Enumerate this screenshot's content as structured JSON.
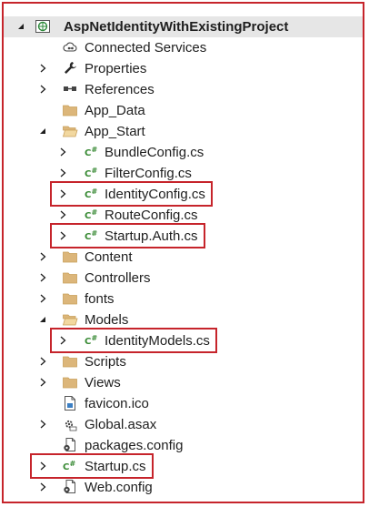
{
  "accent_color": "#c6242b",
  "project": {
    "name": "AspNetIdentityWithExistingProject",
    "expanded": true
  },
  "tree": [
    {
      "label": "Connected Services",
      "icon": "cloud-connected-icon",
      "expander": "none",
      "depth": 1
    },
    {
      "label": "Properties",
      "icon": "wrench-icon",
      "expander": "collapsed",
      "depth": 1
    },
    {
      "label": "References",
      "icon": "references-icon",
      "expander": "collapsed",
      "depth": 1
    },
    {
      "label": "App_Data",
      "icon": "folder-icon",
      "expander": "none",
      "depth": 1
    },
    {
      "label": "App_Start",
      "icon": "folder-open-icon",
      "expander": "expanded",
      "depth": 1
    },
    {
      "label": "BundleConfig.cs",
      "icon": "csharp-file-icon",
      "expander": "collapsed",
      "depth": 2
    },
    {
      "label": "FilterConfig.cs",
      "icon": "csharp-file-icon",
      "expander": "collapsed",
      "depth": 2
    },
    {
      "label": "IdentityConfig.cs",
      "icon": "csharp-file-icon",
      "expander": "collapsed",
      "depth": 2,
      "highlighted": true
    },
    {
      "label": "RouteConfig.cs",
      "icon": "csharp-file-icon",
      "expander": "collapsed",
      "depth": 2
    },
    {
      "label": "Startup.Auth.cs",
      "icon": "csharp-file-icon",
      "expander": "collapsed",
      "depth": 2,
      "highlighted": true
    },
    {
      "label": "Content",
      "icon": "folder-icon",
      "expander": "collapsed",
      "depth": 1
    },
    {
      "label": "Controllers",
      "icon": "folder-icon",
      "expander": "collapsed",
      "depth": 1
    },
    {
      "label": "fonts",
      "icon": "folder-icon",
      "expander": "collapsed",
      "depth": 1
    },
    {
      "label": "Models",
      "icon": "folder-open-icon",
      "expander": "expanded",
      "depth": 1
    },
    {
      "label": "IdentityModels.cs",
      "icon": "csharp-file-icon",
      "expander": "collapsed",
      "depth": 2,
      "highlighted": true
    },
    {
      "label": "Scripts",
      "icon": "folder-icon",
      "expander": "collapsed",
      "depth": 1
    },
    {
      "label": "Views",
      "icon": "folder-icon",
      "expander": "collapsed",
      "depth": 1
    },
    {
      "label": "favicon.ico",
      "icon": "image-file-icon",
      "expander": "none",
      "depth": 1
    },
    {
      "label": "Global.asax",
      "icon": "global-asax-icon",
      "expander": "collapsed",
      "depth": 1
    },
    {
      "label": "packages.config",
      "icon": "config-file-icon",
      "expander": "none",
      "depth": 1
    },
    {
      "label": "Startup.cs",
      "icon": "csharp-file-icon",
      "expander": "collapsed",
      "depth": 1,
      "highlighted": true
    },
    {
      "label": "Web.config",
      "icon": "config-file-icon",
      "expander": "collapsed",
      "depth": 1
    }
  ]
}
